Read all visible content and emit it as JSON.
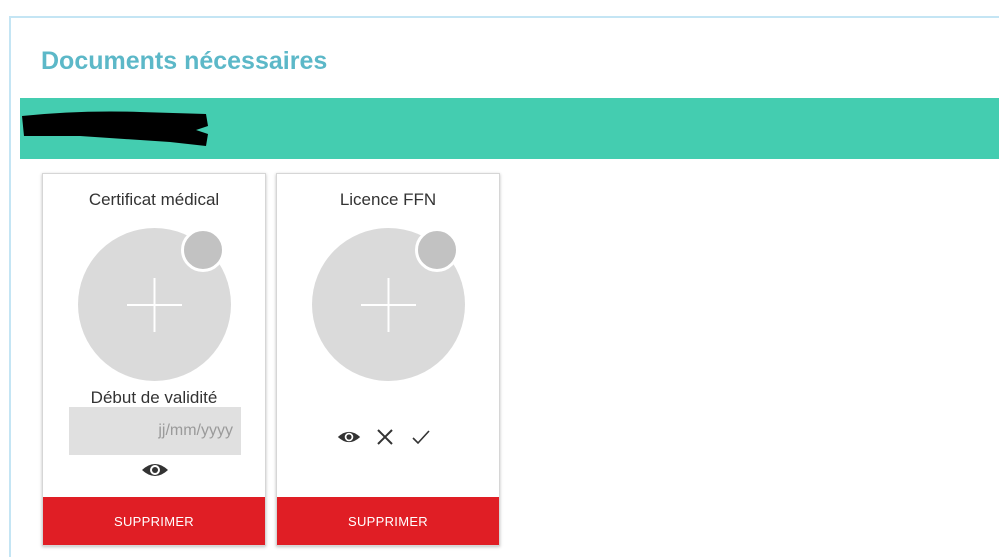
{
  "section": {
    "title": "Documents nécessaires",
    "banner_color": "#44cdb0",
    "banner_text_redacted": true
  },
  "documents": [
    {
      "title": "Certificat médical",
      "upload_icon": "plus-icon",
      "date_label": "Début de validité",
      "date_placeholder": "jj/mm/yyyy",
      "actions": [
        "eye-icon"
      ],
      "delete_label": "SUPPRIMER"
    },
    {
      "title": "Licence FFN",
      "upload_icon": "plus-icon",
      "actions": [
        "eye-icon",
        "close-icon",
        "check-icon"
      ],
      "delete_label": "SUPPRIMER"
    }
  ],
  "colors": {
    "title": "#5cb8c8",
    "delete_button": "#e01e25",
    "upload_circle": "#dadada"
  }
}
